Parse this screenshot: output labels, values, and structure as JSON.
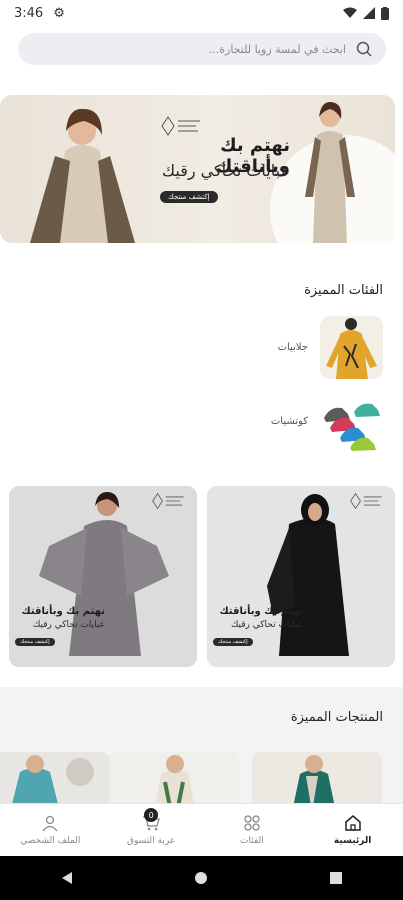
{
  "status": {
    "time": "3:46"
  },
  "search": {
    "placeholder": "ابحث في لمسة زويا للتجارة..."
  },
  "hero": {
    "headline": "نهتم بك وبأناقتك",
    "subline": "عبايات تحاكي رقيك",
    "button": "إكتشف منتجك"
  },
  "featured_categories": {
    "title": "الفئات المميزة",
    "items": [
      {
        "label": "جلابيات"
      },
      {
        "label": "كوتشيات"
      }
    ]
  },
  "promos": [
    {
      "headline": "نهتم بك وبأناقتك",
      "subline": "عبايات تحاكي رقيك",
      "button": "إكتشف منتجك"
    },
    {
      "headline": "نهتم بك وبأناقتك",
      "subline": "عبايات تحاكي رقيك",
      "button": "إكتشف منتجك"
    }
  ],
  "featured_products": {
    "title": "المنتجات المميزة"
  },
  "bottom_nav": {
    "items": [
      {
        "label": "الرئيسية",
        "icon": "home-icon"
      },
      {
        "label": "الفئات",
        "icon": "grid-icon"
      },
      {
        "label": "عربة التسوق",
        "icon": "cart-icon",
        "badge": "0"
      },
      {
        "label": "الملف الشخصي",
        "icon": "user-icon"
      }
    ]
  }
}
